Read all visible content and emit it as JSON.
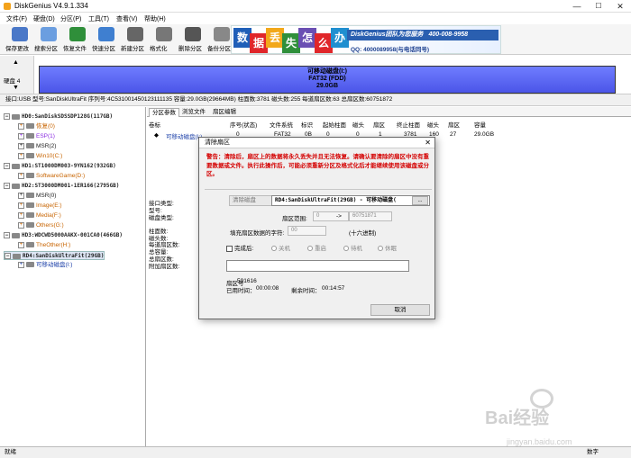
{
  "window": {
    "title": "DiskGenius V4.9.1.334",
    "min": "—",
    "max": "☐",
    "close": "✕"
  },
  "menu": [
    "文件(F)",
    "硬盘(D)",
    "分区(P)",
    "工具(T)",
    "查看(V)",
    "帮助(H)"
  ],
  "toolbar": [
    {
      "label": "保存更改",
      "color": "#4a78c8",
      "icon": "save-icon"
    },
    {
      "label": "搜索分区",
      "color": "#6b9ee0",
      "icon": "search-icon"
    },
    {
      "label": "恢复文件",
      "color": "#2f8f3a",
      "icon": "recover-icon"
    },
    {
      "label": "快速分区",
      "color": "#3f7fd0",
      "icon": "quick-partition-icon"
    },
    {
      "label": "新建分区",
      "color": "#666666",
      "icon": "new-partition-icon"
    },
    {
      "label": "格式化",
      "color": "#777777",
      "icon": "format-icon"
    },
    {
      "label": "删除分区",
      "color": "#555555",
      "icon": "delete-partition-icon"
    },
    {
      "label": "备份分区",
      "color": "#888888",
      "icon": "backup-partition-icon"
    }
  ],
  "banner": {
    "chars": [
      "数",
      "据",
      "丢",
      "失",
      "怎",
      "么",
      "办"
    ],
    "char_colors": [
      "#1f5fb8",
      "#e0262a",
      "#f2a81a",
      "#2f8f3a",
      "#6a4fb3",
      "#e0262a",
      "#1f8fd0"
    ],
    "brand": "DiskGenius团队为您服务",
    "phone": "400-008-9958",
    "qq": "QQ: 4000089958(与电话同号)"
  },
  "disk_map": {
    "disk_label": "硬盘 4",
    "line1": "可移动磁盘(I:)",
    "line2": "FAT32 (FDD)",
    "line3": "29.0GB"
  },
  "info_row": "接口:USB  型号:SanDiskUltraFit  序列号:4C531001450123111135  容量:29.0GB(29664MB)  柱面数:3781  磁头数:255  每道扇区数:63  总扇区数:60751872",
  "tree": [
    {
      "text": "HD0:SanDiskSDSSDP128G(117GB)",
      "type": "disk",
      "indent": 0,
      "color": "c-black"
    },
    {
      "text": "恢复(0)",
      "type": "part",
      "indent": 1,
      "color": "c-orange"
    },
    {
      "text": "ESP(1)",
      "type": "part",
      "indent": 1,
      "color": "c-purple"
    },
    {
      "text": "MSR(2)",
      "type": "part",
      "indent": 1,
      "color": "c-black"
    },
    {
      "text": "Win10(C:)",
      "type": "part",
      "indent": 1,
      "color": "c-orange"
    },
    {
      "text": "HD1:ST1000DM003-9YN162(932GB)",
      "type": "disk",
      "indent": 0,
      "color": "c-black"
    },
    {
      "text": "SoftwareGame(D:)",
      "type": "part",
      "indent": 1,
      "color": "c-orange"
    },
    {
      "text": "HD2:ST3000DM001-1ER166(2795GB)",
      "type": "disk",
      "indent": 0,
      "color": "c-black"
    },
    {
      "text": "MSR(0)",
      "type": "part",
      "indent": 1,
      "color": "c-black"
    },
    {
      "text": "Image(E:)",
      "type": "part",
      "indent": 1,
      "color": "c-orange"
    },
    {
      "text": "Media(F:)",
      "type": "part",
      "indent": 1,
      "color": "c-orange"
    },
    {
      "text": "Others(G:)",
      "type": "part",
      "indent": 1,
      "color": "c-orange"
    },
    {
      "text": "HD3:WDCWD5000AAKX-001CA0(466GB)",
      "type": "disk",
      "indent": 0,
      "color": "c-black"
    },
    {
      "text": "TheOther(H:)",
      "type": "part",
      "indent": 1,
      "color": "c-orange"
    },
    {
      "text": "RD4:SanDiskUltraFit(29GB)",
      "type": "disk",
      "indent": 0,
      "color": "c-black",
      "selected": true
    },
    {
      "text": "可移动磁盘(I:)",
      "type": "part",
      "indent": 1,
      "color": "c-blue"
    }
  ],
  "tabs": [
    "分区参数",
    "浏览文件",
    "扇区编辑"
  ],
  "columns": [
    "卷标",
    "序号(状态)",
    "文件系统",
    "标识",
    "起始柱面",
    "磁头",
    "扇区",
    "终止柱面",
    "磁头",
    "扇区",
    "容量"
  ],
  "row": [
    "可移动磁盘(I:)",
    "0",
    "FAT32",
    "0B",
    "0",
    "0",
    "1",
    "3781",
    "160",
    "27",
    "29.0GB"
  ],
  "side_labels": [
    "接口类型:",
    "型号:",
    "磁盘类型:",
    "柱面数:",
    "磁头数:",
    "每道扇区数:",
    "总容量:",
    "总扇区数:",
    "附加扇区数:"
  ],
  "dialog": {
    "title": "清除扇区",
    "close": "✕",
    "warning": "警告：清除后，扇区上的数据将永久丢失并且无法恢复。请确认要清除的扇区中没有重要数据或文件。执行此操作后，可能必须重新分区及格式化后才能继续使用该磁盘或分区。",
    "scope_select": "清除磁盘",
    "target": "RD4:SanDiskUltraFit(29GB) - 可移动磁盘(",
    "target_btn": "...",
    "range_label": "扇区范围:",
    "range_from": "0",
    "range_arrow": "->",
    "range_to": "60751871",
    "fill_label": "填充扇区数据的字符:",
    "fill_value": "00",
    "fill_hint": "(十六进制)",
    "after_done": "完成后:",
    "radios": [
      "关机",
      "重启",
      "待机",
      "休眠"
    ],
    "progress": 0.0,
    "sector_label": "扇区号",
    "sector_value": "591616",
    "used_label": "已用时间：",
    "used_value": "00:00:08",
    "remain_label": "剩余时间：",
    "remain_value": "00:14:57",
    "cancel": "取消"
  },
  "status": {
    "left": "就绪",
    "right": "数字"
  },
  "watermark": {
    "text": "Bai经验",
    "url": "jingyan.baidu.com"
  }
}
